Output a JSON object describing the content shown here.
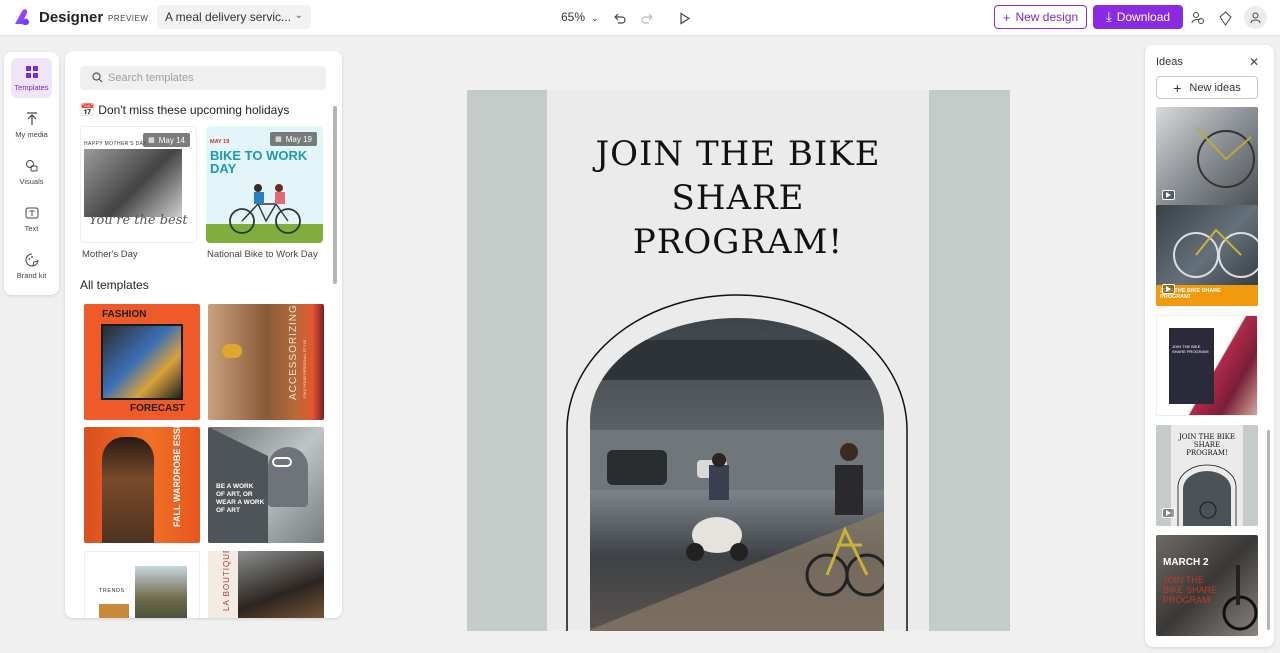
{
  "header": {
    "app_title": "Designer",
    "badge": "PREVIEW",
    "document_name": "A meal delivery servic...",
    "zoom": "65%",
    "new_design": "New design",
    "download": "Download"
  },
  "rail": [
    {
      "label": "Templates",
      "icon": "templates-icon",
      "active": true
    },
    {
      "label": "My media",
      "icon": "upload-icon"
    },
    {
      "label": "Visuals",
      "icon": "visuals-icon"
    },
    {
      "label": "Text",
      "icon": "text-icon"
    },
    {
      "label": "Brand kit",
      "icon": "brand-kit-icon"
    }
  ],
  "templates_panel": {
    "search_placeholder": "Search templates",
    "holidays_heading": "📅 Don't miss these upcoming holidays",
    "holidays": [
      {
        "caption": "Mother's Day",
        "date": "May 14",
        "card_top": "HAPPY MOTHER'S DAY",
        "card_script": "You're the best"
      },
      {
        "caption": "National Bike to Work Day",
        "date": "May 19",
        "card_top": "MAY 19",
        "card_title_1": "BIKE TO WORK",
        "card_title_2": "DAY"
      }
    ],
    "all_heading": "All templates",
    "templates": [
      {
        "top": "FASHION",
        "bottom": "FORECAST"
      },
      {
        "vertical": "ACCESSORIZING",
        "small": "FIND YOUR PERSONAL STYLE"
      },
      {
        "vertical": "FALL WARDROBE ESSENTIALS"
      },
      {
        "quote_1": "BE A WORK",
        "quote_2": "OF ART, OR",
        "quote_3": "WEAR A WORK",
        "quote_4": "OF ART"
      },
      {
        "small": "TRENDS"
      },
      {
        "vertical": "LA BOUTIQUE"
      }
    ]
  },
  "canvas": {
    "headline_1": "JOIN THE BIKE",
    "headline_2": "SHARE",
    "headline_3": "PROGRAM!"
  },
  "ideas": {
    "title": "Ideas",
    "new_ideas": "New ideas",
    "idea2_text_1": "JOIN THE BIKE SHARE",
    "idea2_text_2": "PROGRAM!",
    "idea3_text_1": "JOIN THE BIKE",
    "idea3_text_2": "SHARE PROGRAM!",
    "idea4_text_1": "JOIN THE BIKE",
    "idea4_text_2": "SHARE",
    "idea4_text_3": "PROGRAM!",
    "idea5_text_1": "MARCH 2",
    "idea5_text_2": "JOIN THE",
    "idea5_text_3": "BIKE SHARE",
    "idea5_text_4": "PROGRAM!"
  },
  "colors": {
    "accent": "#8a2be2",
    "canvas_bg": "#c5cbc8"
  }
}
